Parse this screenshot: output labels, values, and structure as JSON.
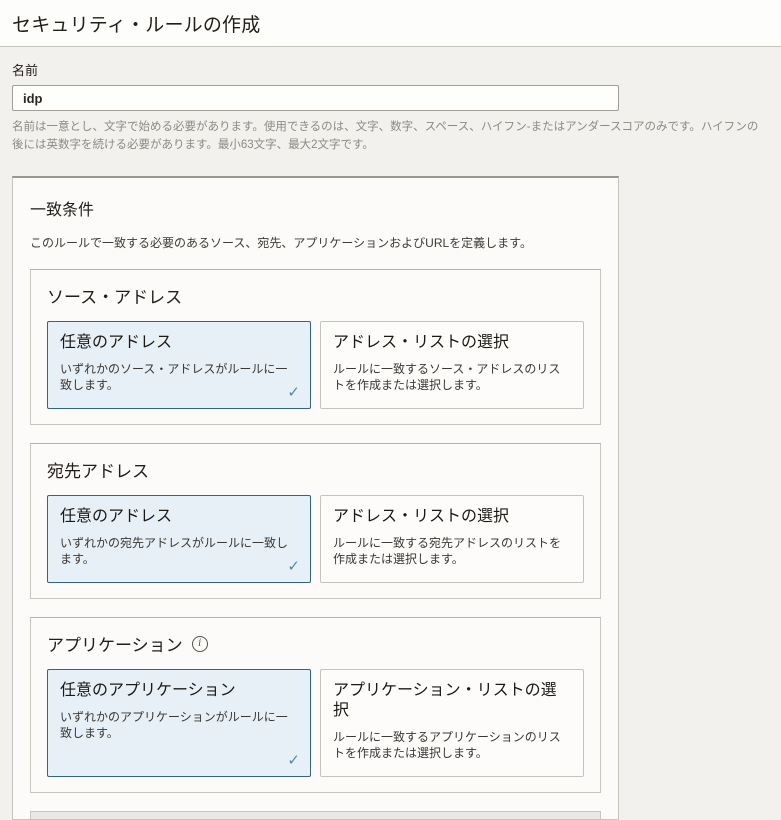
{
  "page": {
    "title": "セキュリティ・ルールの作成"
  },
  "name_field": {
    "label": "名前",
    "value": "idp",
    "helper": "名前は一意とし、文字で始める必要があります。使用できるのは、文字、数字、スペース、ハイフン-またはアンダースコアのみです。ハイフンの後には英数字を続ける必要があります。最小63文字、最大2文字です。"
  },
  "match_criteria": {
    "title": "一致条件",
    "description": "このルールで一致する必要のあるソース、宛先、アプリケーションおよびURLを定義します。",
    "sections": [
      {
        "title": "ソース・アドレス",
        "cards": [
          {
            "title": "任意のアドレス",
            "description": "いずれかのソース・アドレスがルールに一致します。",
            "selected": true
          },
          {
            "title": "アドレス・リストの選択",
            "description": "ルールに一致するソース・アドレスのリストを作成または選択します。",
            "selected": false
          }
        ]
      },
      {
        "title": "宛先アドレス",
        "cards": [
          {
            "title": "任意のアドレス",
            "description": "いずれかの宛先アドレスがルールに一致します。",
            "selected": true
          },
          {
            "title": "アドレス・リストの選択",
            "description": "ルールに一致する宛先アドレスのリストを作成または選択します。",
            "selected": false
          }
        ]
      },
      {
        "title": "アプリケーション",
        "cards": [
          {
            "title": "任意のアプリケーション",
            "description": "いずれかのアプリケーションがルールに一致します。",
            "selected": true
          },
          {
            "title": "アプリケーション・リストの選択",
            "description": "ルールに一致するアプリケーションのリストを作成または選択します。",
            "selected": false
          }
        ]
      }
    ]
  },
  "icons": {
    "selected_check": "✓",
    "info": "i"
  },
  "colors": {
    "selected_border": "#2f648c",
    "selected_background": "#e7f0f7",
    "checkmark": "#4f8cab",
    "page_background": "#f2f1ee"
  }
}
